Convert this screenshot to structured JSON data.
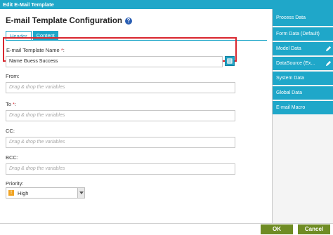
{
  "window": {
    "title": "Edit E-Mail Template"
  },
  "page": {
    "heading": "E-mail Template Configuration",
    "help_icon": "?"
  },
  "tabs": [
    {
      "label": "Header",
      "active": true
    },
    {
      "label": "Content",
      "active": false
    }
  ],
  "form": {
    "template_name": {
      "label": "E-mail Template Name",
      "required_mark": "*",
      "colon": ":",
      "value": "Name Guess Success"
    },
    "from": {
      "label": "From:",
      "placeholder": "Drag & drop the variables"
    },
    "to": {
      "label": "To",
      "required_mark": "*",
      "colon": ":",
      "placeholder": "Drag & drop the variables"
    },
    "cc": {
      "label": "CC:",
      "placeholder": "Drag & drop the variables"
    },
    "bcc": {
      "label": "BCC:",
      "placeholder": "Drag & drop the variables"
    },
    "priority": {
      "label": "Priority:",
      "selected": "High",
      "icon": "priority-high-icon"
    }
  },
  "sidebar": {
    "items": [
      {
        "label": "Process Data",
        "has_edit": false
      },
      {
        "label": "Form Data (Default)",
        "has_edit": false
      },
      {
        "label": "Model Data",
        "has_edit": true
      },
      {
        "label": "DataSource (Ex...",
        "has_edit": true
      },
      {
        "label": "System Data",
        "has_edit": false
      },
      {
        "label": "Global Data",
        "has_edit": false
      },
      {
        "label": "E-mail Macro",
        "has_edit": false
      }
    ]
  },
  "footer": {
    "ok_label": "OK",
    "cancel_label": "Cancel"
  },
  "colors": {
    "accent": "#1fa7c9",
    "highlight_border": "#d9262e",
    "button_green": "#6f8c24",
    "required": "#d9262e"
  }
}
